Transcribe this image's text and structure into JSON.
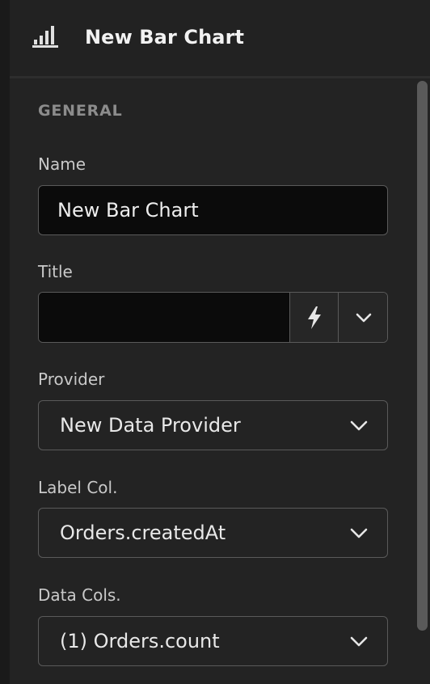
{
  "header": {
    "icon": "bar-chart-icon",
    "title": "New Bar Chart"
  },
  "section": {
    "heading": "GENERAL"
  },
  "fields": {
    "name": {
      "label": "Name",
      "value": "New Bar Chart"
    },
    "title": {
      "label": "Title",
      "value": "",
      "dynamic_icon": "lightning-bolt-icon",
      "dropdown_icon": "chevron-down-icon"
    },
    "provider": {
      "label": "Provider",
      "value": "New Data Provider"
    },
    "label_col": {
      "label": "Label Col.",
      "value": "Orders.createdAt"
    },
    "data_cols": {
      "label": "Data Cols.",
      "value": "(1) Orders.count"
    }
  }
}
